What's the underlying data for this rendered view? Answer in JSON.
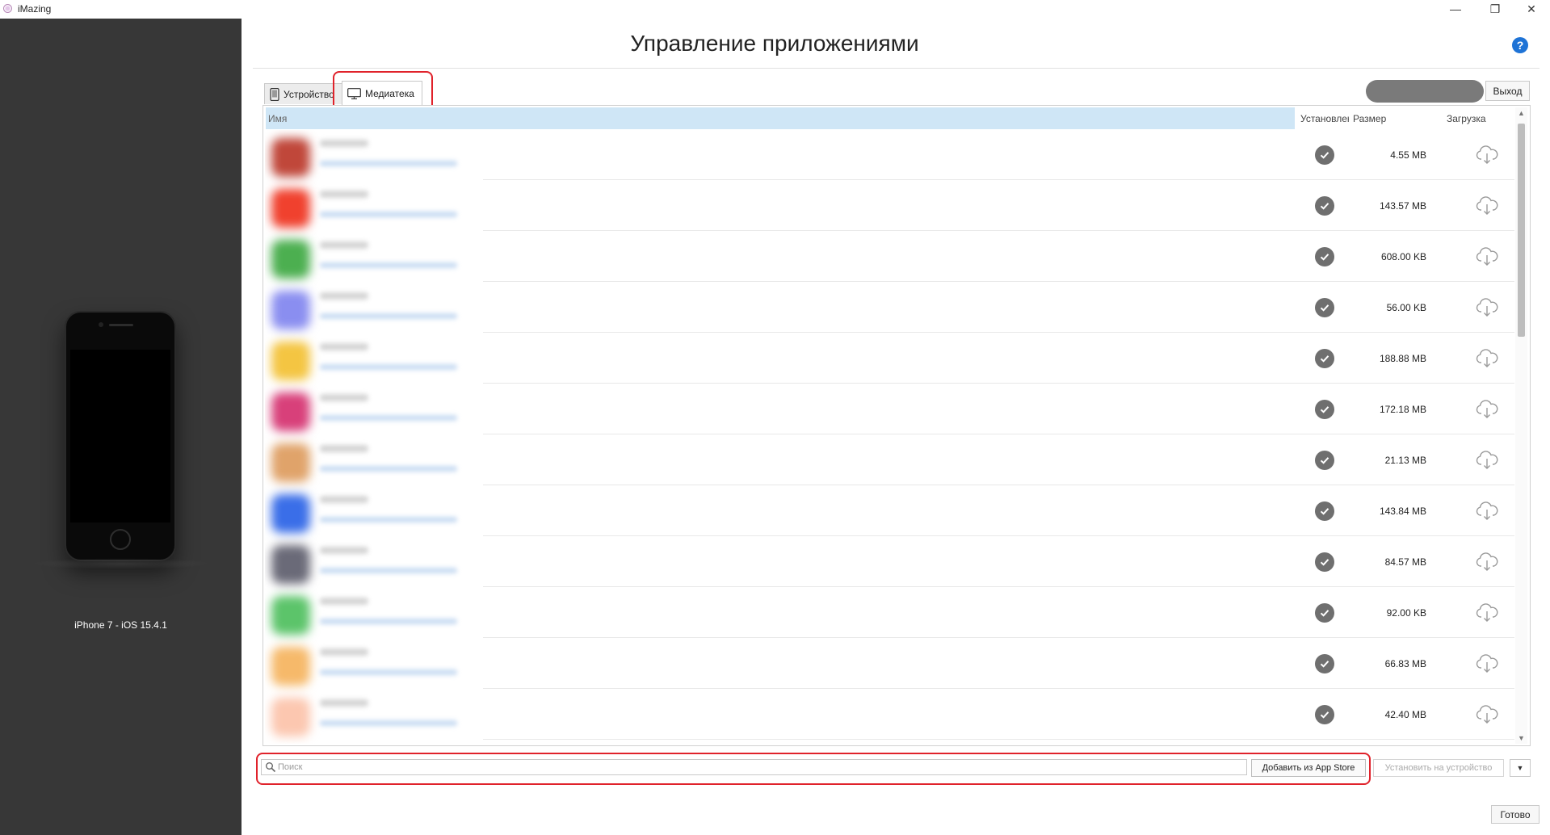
{
  "window": {
    "app_name": "iMazing",
    "minimize": "—",
    "maximize": "❐",
    "close": "✕"
  },
  "sidebar": {
    "device_label": "iPhone 7 - iOS 15.4.1"
  },
  "header": {
    "title": "Управление приложениями",
    "help": "?"
  },
  "tabs": [
    {
      "label": "Устройство",
      "icon": "phone-icon",
      "active": false
    },
    {
      "label": "Медиатека",
      "icon": "monitor-icon",
      "active": true
    }
  ],
  "logout_label": "Выход",
  "table": {
    "columns": [
      "Имя",
      "Установлено",
      "Размер",
      "Загрузка"
    ],
    "rows": [
      {
        "size": "4.55 MB",
        "installed": true,
        "icon_color": "#c0473a"
      },
      {
        "size": "143.57 MB",
        "installed": true,
        "icon_color": "#f0412e"
      },
      {
        "size": "608.00 KB",
        "installed": true,
        "icon_color": "#4caf50"
      },
      {
        "size": "56.00 KB",
        "installed": true,
        "icon_color": "#8a8ef0"
      },
      {
        "size": "188.88 MB",
        "installed": true,
        "icon_color": "#f4c542"
      },
      {
        "size": "172.18 MB",
        "installed": true,
        "icon_color": "#d8407a"
      },
      {
        "size": "21.13 MB",
        "installed": true,
        "icon_color": "#e0a36a"
      },
      {
        "size": "143.84 MB",
        "installed": true,
        "icon_color": "#3a6ee8"
      },
      {
        "size": "84.57 MB",
        "installed": true,
        "icon_color": "#6a6a78"
      },
      {
        "size": "92.00 KB",
        "installed": true,
        "icon_color": "#5cc46a"
      },
      {
        "size": "66.83 MB",
        "installed": true,
        "icon_color": "#f6b96a"
      },
      {
        "size": "42.40 MB",
        "installed": true,
        "icon_color": "#fcc7b0"
      }
    ]
  },
  "toolbar": {
    "search_placeholder": "Поиск",
    "add_from_appstore": "Добавить из App Store",
    "install_to_device": "Установить на устройство",
    "dropdown": "▼"
  },
  "done_label": "Готово",
  "colors": {
    "accent_highlight": "#e0222b",
    "sidebar_bg": "#373737",
    "header_row_bg": "#cfe6f6"
  }
}
